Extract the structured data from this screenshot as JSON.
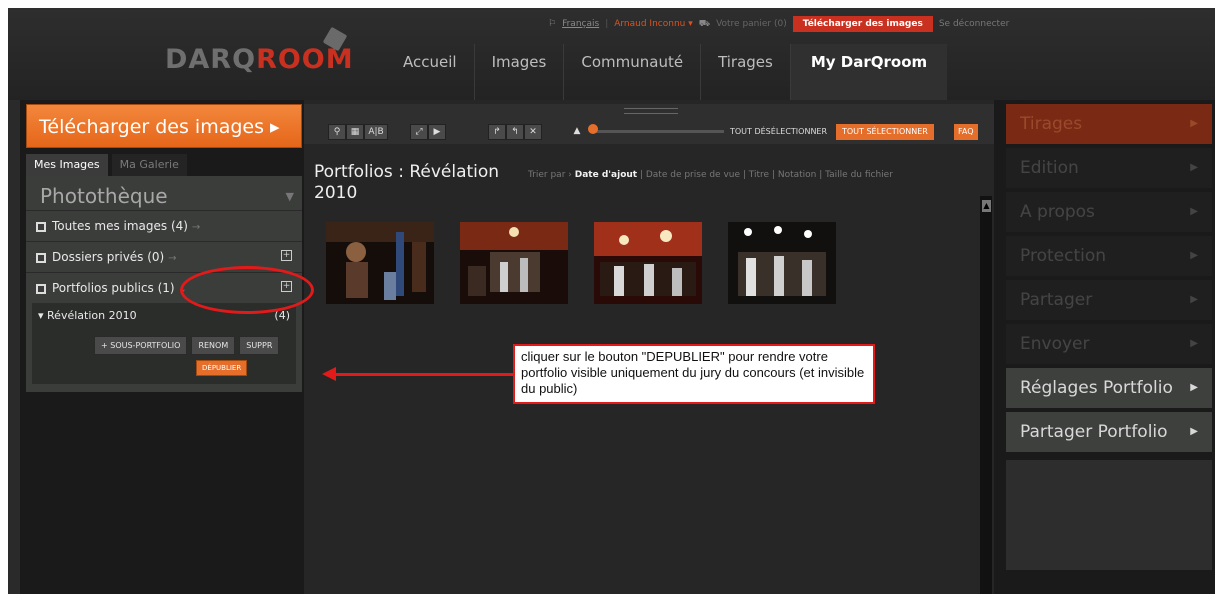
{
  "app": {
    "logo_part1": "DARQ",
    "logo_part2": "ROOM"
  },
  "topbar": {
    "language": "Français",
    "user": "Arnaud Inconnu ▾",
    "cart": "Votre panier (0)",
    "download_button": "Télécharger des images",
    "logout": "Se déconnecter"
  },
  "nav": [
    "Accueil",
    "Images",
    "Communauté",
    "Tirages",
    "My DarQroom"
  ],
  "left": {
    "upload_button": "Télécharger des images ▸",
    "tabs": [
      "Mes Images",
      "Ma Galerie"
    ],
    "library_title": "Photothèque",
    "rows": [
      {
        "label": "Toutes mes images (4)",
        "arrow": "→"
      },
      {
        "label": "Dossiers privés (0)",
        "arrow": "→"
      },
      {
        "label": "Portfolios publics (1)",
        "arrow": "↓"
      }
    ],
    "folder": {
      "name": "Révélation 2010",
      "count": "(4)",
      "buttons": [
        "+ SOUS-PORTFOLIO",
        "RENOM",
        "SUPPR"
      ],
      "depublish": "DÉPUBLIER"
    }
  },
  "toolbar": {
    "tools": [
      "⚲",
      "▦",
      "A|B",
      "⤢",
      "▶",
      "↱",
      "↰",
      "✕"
    ],
    "deselect_all": "TOUT DÉSÉLECTIONNER",
    "select_all": "TOUT SÉLECTIONNER",
    "faq": "FAQ"
  },
  "portfolio": {
    "title": "Portfolios : Révélation 2010",
    "sort_label": "Trier par ›",
    "sort_options": [
      "Date d'ajout",
      "Date de prise de vue",
      "Titre",
      "Notation",
      "Taille du fichier"
    ],
    "sort_active": "Date d'ajout"
  },
  "right_menu": [
    {
      "label": "Tirages",
      "state": "first"
    },
    {
      "label": "Edition",
      "state": "disabled"
    },
    {
      "label": "A propos",
      "state": "disabled"
    },
    {
      "label": "Protection",
      "state": "disabled"
    },
    {
      "label": "Partager",
      "state": "disabled"
    },
    {
      "label": "Envoyer",
      "state": "disabled"
    },
    {
      "label": "Réglages Portfolio",
      "state": "active"
    },
    {
      "label": "Partager Portfolio",
      "state": "active"
    }
  ],
  "annotation": {
    "text": "cliquer sur le bouton \"DEPUBLIER\" pour rendre votre portfolio visible uniquement du jury du concours (et invisible du public)"
  },
  "colors": {
    "accent": "#e46e2a",
    "brand_red": "#c9301f",
    "annotation_red": "#e21a1a"
  }
}
